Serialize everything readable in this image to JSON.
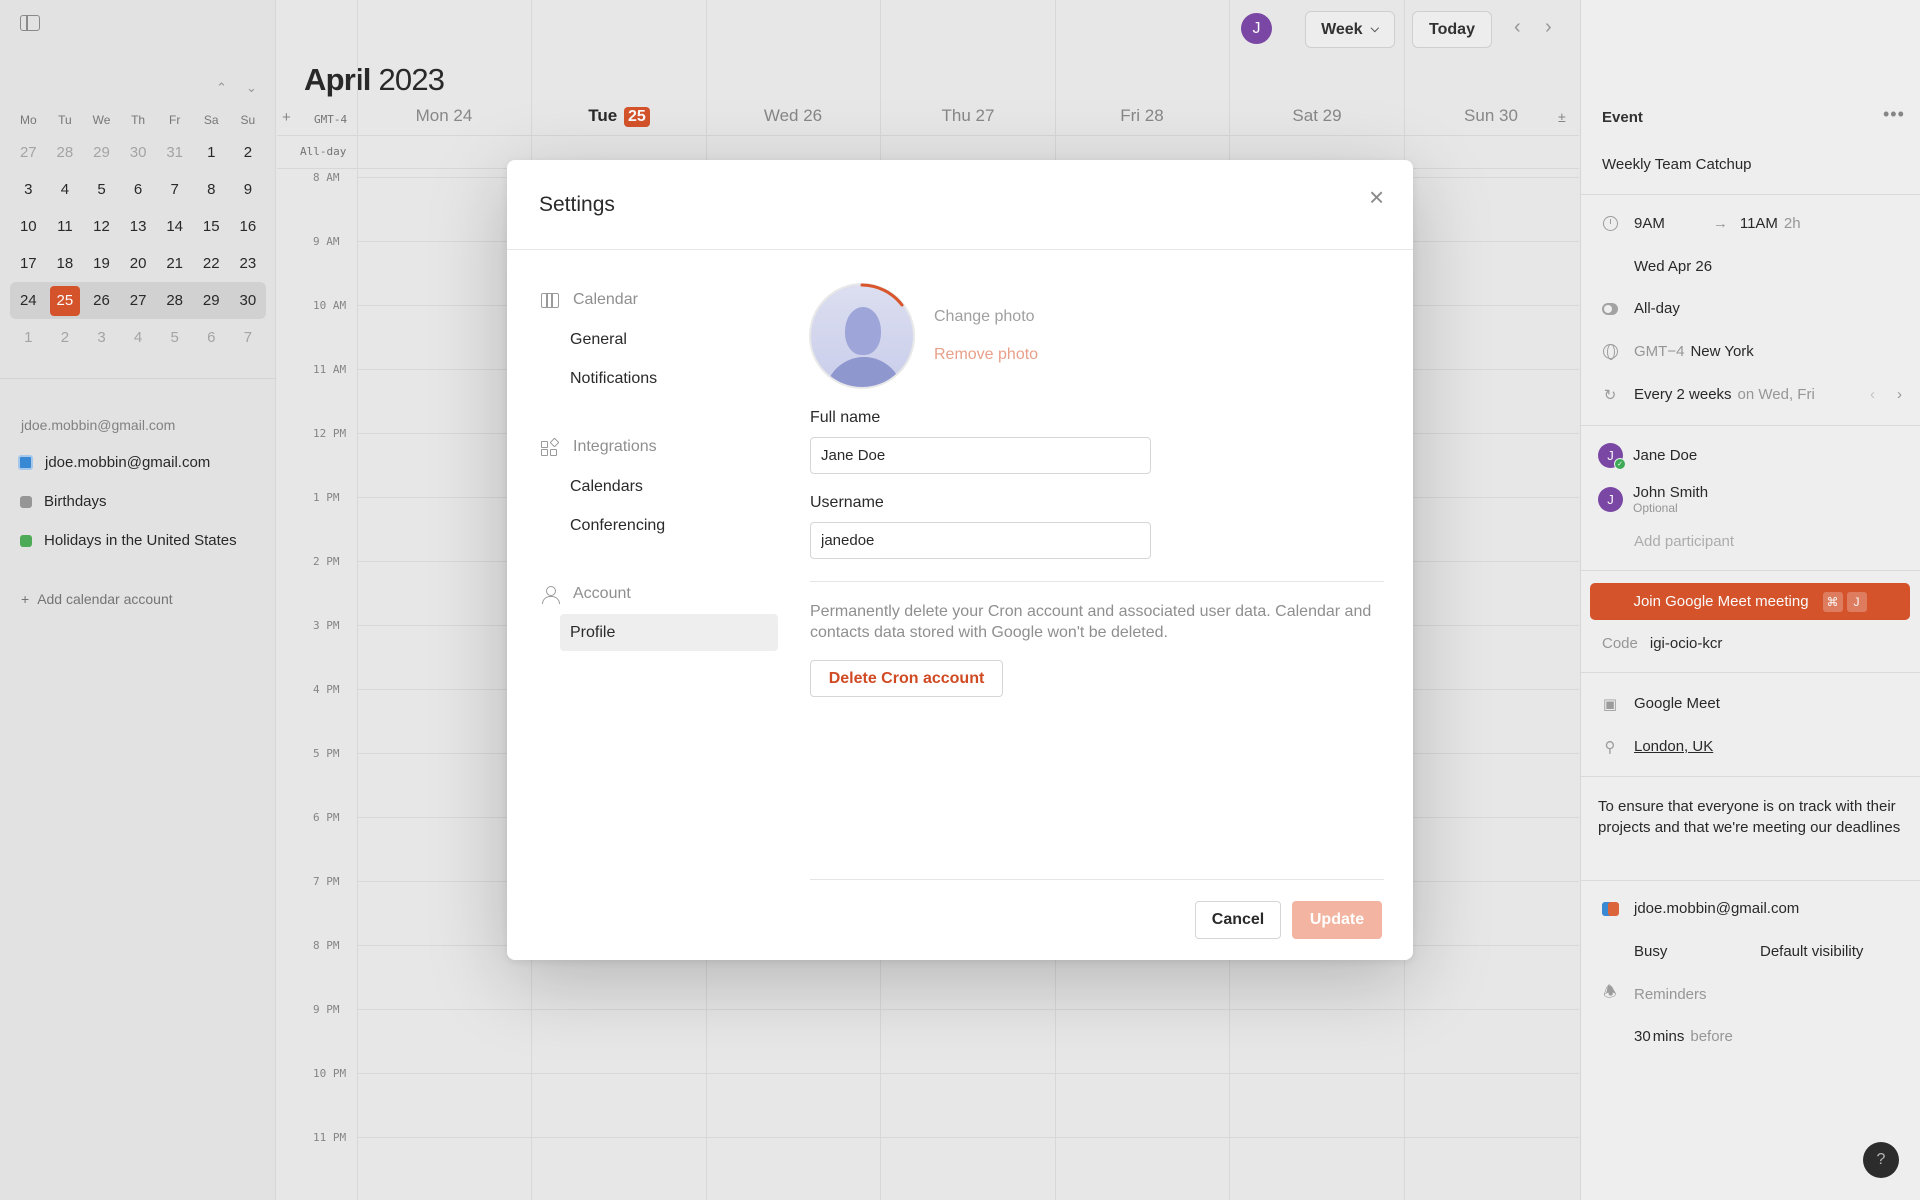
{
  "sidebar": {
    "weekday_headers": [
      "Mo",
      "Tu",
      "We",
      "Th",
      "Fr",
      "Sa",
      "Su"
    ],
    "mini_calendar_rows": [
      [
        "27",
        "28",
        "29",
        "30",
        "31",
        "1",
        "2"
      ],
      [
        "3",
        "4",
        "5",
        "6",
        "7",
        "8",
        "9"
      ],
      [
        "10",
        "11",
        "12",
        "13",
        "14",
        "15",
        "16"
      ],
      [
        "17",
        "18",
        "19",
        "20",
        "21",
        "22",
        "23"
      ],
      [
        "24",
        "25",
        "26",
        "27",
        "28",
        "29",
        "30"
      ],
      [
        "1",
        "2",
        "3",
        "4",
        "5",
        "6",
        "7"
      ]
    ],
    "nav_up_icon": "⌃",
    "nav_down_icon": "⌄",
    "account_label": "jdoe.mobbin@gmail.com",
    "calendars": [
      {
        "label": "jdoe.mobbin@gmail.com",
        "color": "#3b8bd9"
      },
      {
        "label": "Birthdays",
        "color": "#9a9a9a"
      },
      {
        "label": "Holidays in the United States",
        "color": "#4fae58"
      }
    ],
    "add_account": {
      "icon": "+",
      "label": "Add calendar account"
    }
  },
  "toolbar": {
    "avatar_initial": "J",
    "view_label": "Week",
    "today_label": "Today",
    "prev_icon": "‹",
    "next_icon": "›"
  },
  "header": {
    "month": "April",
    "year": "2023",
    "plus": "+",
    "timezone": "GMT-4",
    "tz_toggle": "±",
    "all_day_label": "All-day",
    "days": [
      {
        "label": "Mon 24"
      },
      {
        "label": "Tue",
        "badge": "25"
      },
      {
        "label": "Wed 26"
      },
      {
        "label": "Thu 27"
      },
      {
        "label": "Fri 28"
      },
      {
        "label": "Sat 29"
      },
      {
        "label": "Sun 30"
      }
    ],
    "hours": [
      "8 AM",
      "9 AM",
      "10 AM",
      "11 AM",
      "12 PM",
      "1 PM",
      "2 PM",
      "3 PM",
      "4 PM",
      "5 PM",
      "6 PM",
      "7 PM",
      "8 PM",
      "9 PM",
      "10 PM",
      "11 PM"
    ]
  },
  "event_panel": {
    "title": "Event",
    "more_icon": "•••",
    "event_name": "Weekly Team Catchup",
    "start_time": "9AM",
    "arrow": "→",
    "end_time": "11AM",
    "duration": "2h",
    "date": "Wed Apr 26",
    "all_day_label": "All-day",
    "tz_offset": "GMT−4",
    "tz_city": "New York",
    "recurrence": "Every 2 weeks",
    "recurrence_days": "on Wed, Fri",
    "prev_icon": "‹",
    "next_icon": "›",
    "participants": [
      {
        "initial": "J",
        "name": "Jane Doe",
        "note": ""
      },
      {
        "initial": "J",
        "name": "John Smith",
        "note": "Optional"
      }
    ],
    "add_participant_placeholder": "Add participant",
    "join_label": "Join Google Meet meeting",
    "join_shortcut": [
      "⌘",
      "J"
    ],
    "code_label": "Code",
    "code_value": "igi-ocio-kcr",
    "conference": "Google Meet",
    "location": "London, UK",
    "description": "To ensure that everyone is on track with their projects and that we're meeting our deadlines",
    "calendar_account": "jdoe.mobbin@gmail.com",
    "availability": "Busy",
    "visibility": "Default visibility",
    "reminders_label": "Reminders",
    "reminder_value": "30",
    "reminder_unit": "mins",
    "reminder_suffix": "before",
    "help": "?"
  },
  "settings": {
    "title": "Settings",
    "close_icon": "×",
    "nav": {
      "calendar_section": "Calendar",
      "general": "General",
      "notifications": "Notifications",
      "integrations_section": "Integrations",
      "calendars": "Calendars",
      "conferencing": "Conferencing",
      "account_section": "Account",
      "profile": "Profile"
    },
    "profile": {
      "change_photo": "Change photo",
      "remove_photo": "Remove photo",
      "full_name_label": "Full name",
      "full_name_value": "Jane Doe",
      "username_label": "Username",
      "username_value": "janedoe",
      "danger_text": "Permanently delete your Cron account and associated user data. Calendar and contacts data stored with Google won't be deleted.",
      "delete_button": "Delete Cron account"
    },
    "cancel_button": "Cancel",
    "update_button": "Update"
  },
  "colors": {
    "accent": "#d9552b",
    "avatar": "#7d4aa8",
    "update_disabled": "#f3b5a1"
  }
}
